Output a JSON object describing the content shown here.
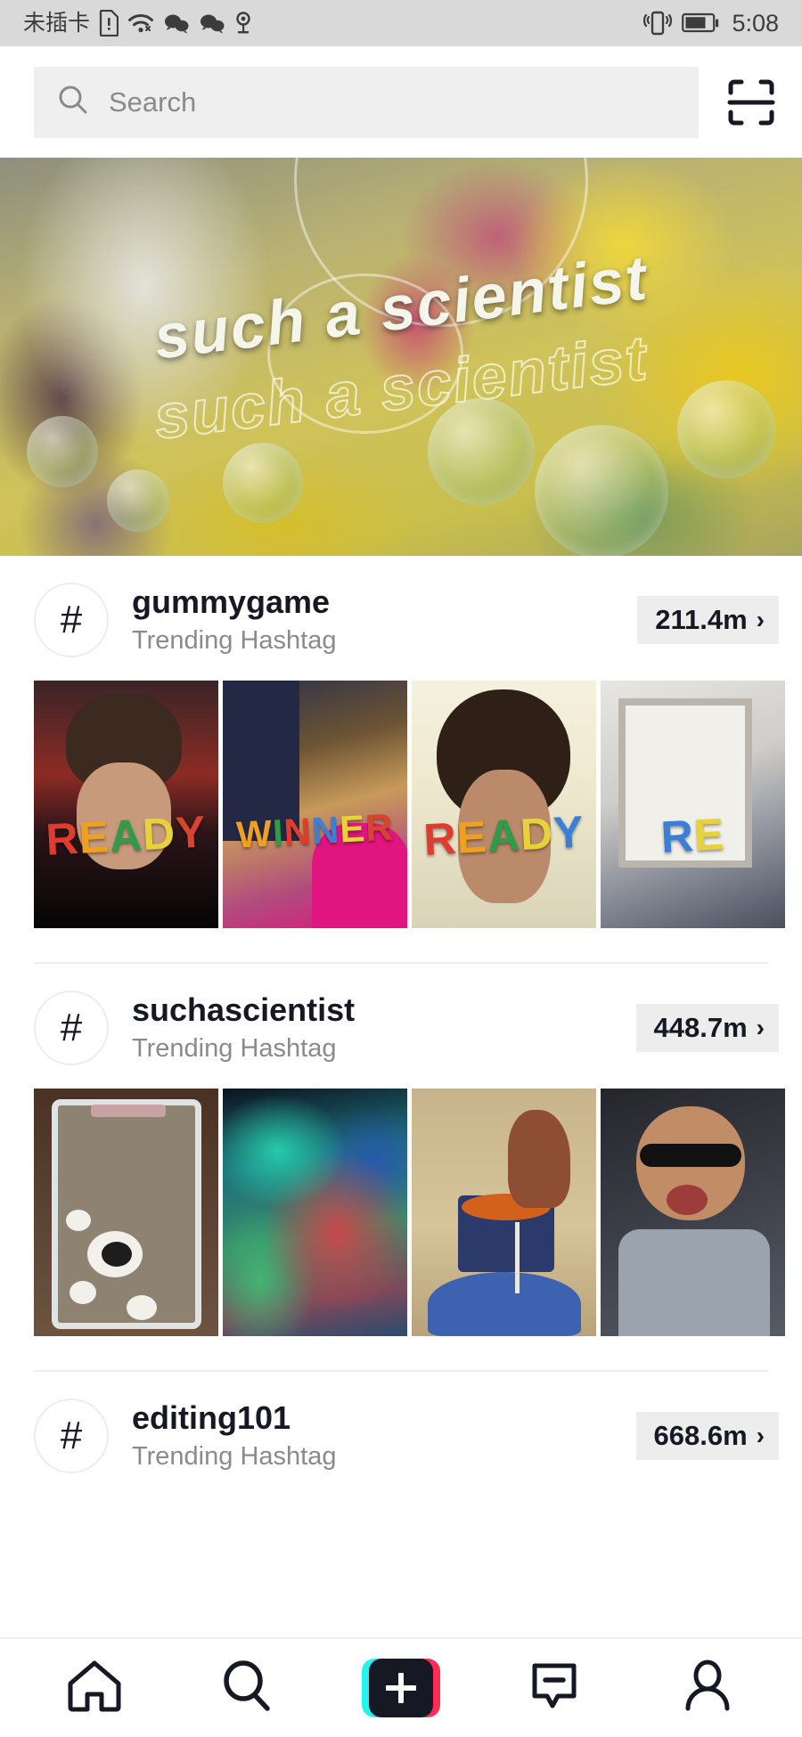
{
  "status_bar": {
    "carrier_text": "未插卡",
    "time": "5:08",
    "icons": [
      "sim-alert-icon",
      "wifi-icon",
      "wechat-icon",
      "wechat-icon",
      "location-pin-icon",
      "vibrate-icon",
      "battery-icon"
    ],
    "battery_level": 70,
    "background_color": "#d9d9d9"
  },
  "header": {
    "search_placeholder": "Search",
    "search_value": "",
    "scan_icon": "qr-scan-icon"
  },
  "banner": {
    "title": "such a scientist",
    "echo_title": "such a scientist",
    "alt": "Hand pouring dark purple liquid from a glass flask into a beaker in a lab with yellow background and bubbles"
  },
  "hashtags": [
    {
      "name": "gummygame",
      "subtitle": "Trending Hashtag",
      "count": "211.4m",
      "chevron": "›",
      "hash_glyph": "#",
      "thumbnails": [
        {
          "label": "READY",
          "alt": "Teen boy with gummy letters over eyes on dark background"
        },
        {
          "label": "WINNER",
          "alt": "Person in pink hoodie with gummy letters, falling candy"
        },
        {
          "label": "READY",
          "alt": "Curly haired person with gummy letters over eyes"
        },
        {
          "label": "RE",
          "alt": "Partially visible person with gummy letters near doorway"
        }
      ]
    },
    {
      "name": "suchascientist",
      "subtitle": "Trending Hashtag",
      "count": "448.7m",
      "chevron": "›",
      "hash_glyph": "#",
      "thumbnails": [
        {
          "label": "",
          "alt": "Clear plastic container with white blobs and black object"
        },
        {
          "label": "",
          "alt": "Colorful thermal-style green red and blue abstract image"
        },
        {
          "label": "",
          "alt": "Hand pouring liquid from orange cup into blue balloon"
        },
        {
          "label": "",
          "alt": "Bald man with sunglasses and beard reacting"
        }
      ]
    },
    {
      "name": "editing101",
      "subtitle": "Trending Hashtag",
      "count": "668.6m",
      "chevron": "›",
      "hash_glyph": "#",
      "thumbnails": []
    }
  ],
  "bottom_nav": [
    {
      "id": "home",
      "icon": "home-icon",
      "active": false
    },
    {
      "id": "discover",
      "icon": "search-icon",
      "active": false
    },
    {
      "id": "create",
      "icon": "plus-icon",
      "active": true
    },
    {
      "id": "inbox",
      "icon": "message-icon",
      "active": false
    },
    {
      "id": "profile",
      "icon": "person-icon",
      "active": false
    }
  ],
  "colors": {
    "accent_cyan": "#25f4ee",
    "accent_pink": "#fe2c55",
    "text_primary": "#161823",
    "text_secondary": "#8a8a8f",
    "badge_bg": "#ededed",
    "search_bg": "#efefef"
  }
}
